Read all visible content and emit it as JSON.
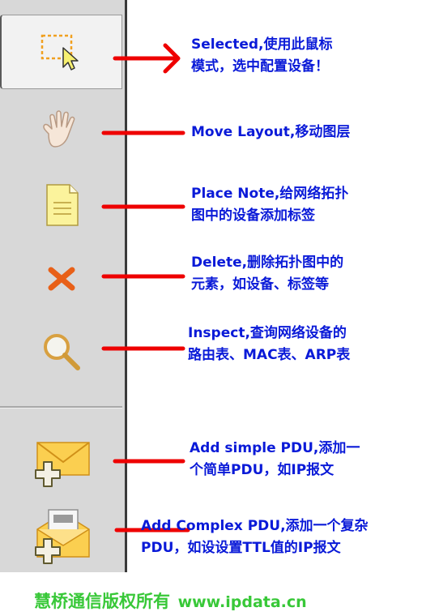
{
  "toolbar": {
    "tools": [
      {
        "name": "select",
        "icon": "select-marquee-icon",
        "label": "Selected,使用此鼠标",
        "label2": "模式，选中配置设备！",
        "selected": true
      },
      {
        "name": "move",
        "icon": "hand-icon",
        "label": "Move Layout,移动图层"
      },
      {
        "name": "note",
        "icon": "note-icon",
        "label": "Place Note,给网络拓扑",
        "label2": "图中的设备添加标签"
      },
      {
        "name": "delete",
        "icon": "delete-x-icon",
        "label": "Delete,删除拓扑图中的",
        "label2": "元素，如设备、标签等"
      },
      {
        "name": "inspect",
        "icon": "magnifier-icon",
        "label": "Inspect,查询网络设备的",
        "label2": "路由表、MAC表、ARP表"
      },
      {
        "name": "simple-pdu",
        "icon": "envelope-plus-icon",
        "label": "Add simple PDU,添加一",
        "label2": "个简单PDU，如IP报文"
      },
      {
        "name": "complex-pdu",
        "icon": "open-envelope-plus-icon",
        "label": "Add Complex PDU,添加一个复杂",
        "label2": "PDU，如设设置TTL值的IP报文"
      }
    ]
  },
  "footer": {
    "copyright": "慧桥通信版权所有",
    "url": "www.ipdata.cn"
  },
  "colors": {
    "label": "#0a1ad8",
    "arrow": "#ee0000",
    "footer": "#38c838",
    "toolbar_bg": "#d8d8d8"
  }
}
